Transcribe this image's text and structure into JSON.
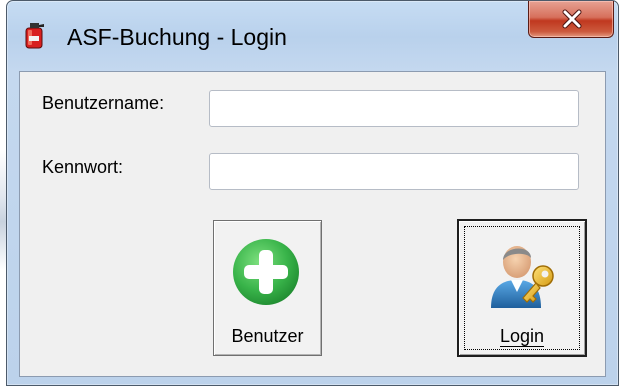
{
  "window": {
    "title": "ASF-Buchung - Login",
    "app_icon": "fire-extinguisher-icon",
    "close_icon": "close-icon",
    "accent_color": "#c7d9ee",
    "close_color": "#c7422a"
  },
  "form": {
    "username_label": "Benutzername:",
    "username_value": "",
    "password_label": "Kennwort:",
    "password_value": ""
  },
  "buttons": {
    "benutzer": {
      "label": "Benutzer",
      "icon": "add-plus-icon",
      "icon_color": "#3cb44b"
    },
    "login": {
      "label": "Login",
      "icon": "user-key-icon"
    }
  }
}
